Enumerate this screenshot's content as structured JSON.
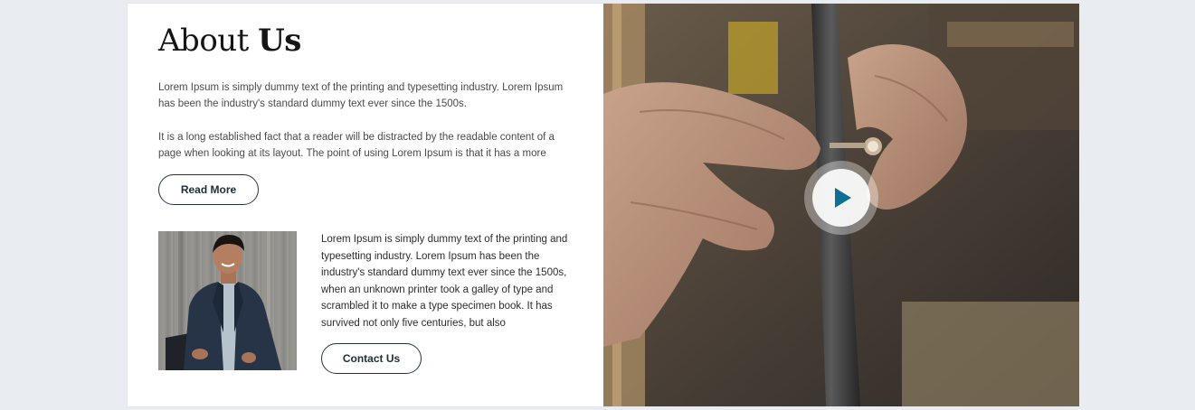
{
  "about": {
    "title_light": "About ",
    "title_bold": "Us",
    "paragraph1": "Lorem Ipsum is simply dummy text of the printing and typesetting industry. Lorem Ipsum has been the industry's standard dummy text ever since the 1500s.",
    "paragraph2": "It is a long established fact that a reader will be distracted by the readable content of a page when looking at its layout. The point of using Lorem Ipsum is that it has a more",
    "read_more_label": "Read More"
  },
  "person": {
    "text": "Lorem Ipsum is simply dummy text of the printing and typesetting industry. Lorem Ipsum has been the industry's standard dummy text ever since the 1500s, when an unknown printer took a galley of type and scrambled it to make a type specimen book. It has survived not only five centuries, but also",
    "contact_label": "Contact Us"
  },
  "video": {
    "play_icon": "play-icon",
    "accent_color": "#0e6f97"
  }
}
